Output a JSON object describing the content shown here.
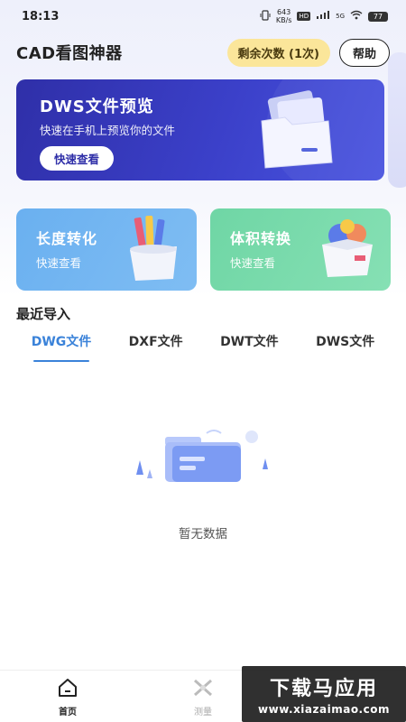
{
  "status_bar": {
    "time": "18:13",
    "net_speed_value": "643",
    "net_speed_unit": "KB/s",
    "hd": "HD",
    "signal_label": "5G",
    "battery": "77"
  },
  "header": {
    "title": "CAD看图神器",
    "remaining_label": "剩余次数 (1次)",
    "help_label": "帮助"
  },
  "banner": {
    "title": "DWS文件预览",
    "subtitle": "快速在手机上预览你的文件",
    "button_label": "快速查看"
  },
  "cards": [
    {
      "title": "长度转化",
      "subtitle": "快速查看"
    },
    {
      "title": "体积转换",
      "subtitle": "快速查看"
    }
  ],
  "recent": {
    "title": "最近导入",
    "tabs": [
      "DWG文件",
      "DXF文件",
      "DWT文件",
      "DWS文件"
    ],
    "active_tab": "DWG文件",
    "empty_text": "暂无数据"
  },
  "bottom_nav": {
    "items": [
      {
        "label": "首页",
        "icon": "home-icon"
      },
      {
        "label": "测量",
        "icon": "measure-icon"
      }
    ]
  },
  "watermark": {
    "title": "下载马应用",
    "url": "www.xiazaimao.com"
  },
  "colors": {
    "banner": "#3b40c9",
    "card_length": "#6ab0f0",
    "card_volume": "#6fd6a5",
    "accent": "#3a82d9",
    "badge": "#fbe69a"
  }
}
